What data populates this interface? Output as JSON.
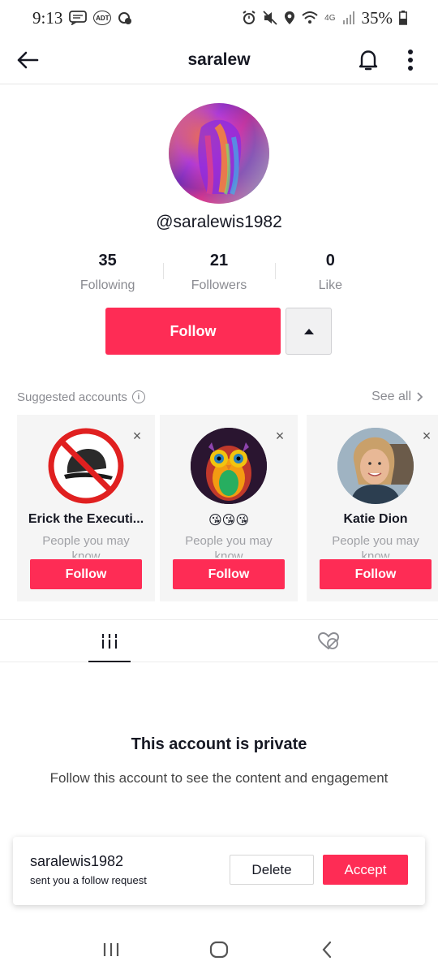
{
  "status_bar": {
    "time": "9:13",
    "network": "4G",
    "battery": "35%",
    "badge_text": "ADT"
  },
  "header": {
    "title": "saralew"
  },
  "profile": {
    "handle": "@saralewis1982",
    "stats": [
      {
        "value": "35",
        "label": "Following"
      },
      {
        "value": "21",
        "label": "Followers"
      },
      {
        "value": "0",
        "label": "Like"
      }
    ],
    "follow_label": "Follow"
  },
  "suggested": {
    "title": "Suggested accounts",
    "see_all": "See all",
    "cards": [
      {
        "name": "Erick the Executi...",
        "sub": "People you may know",
        "follow": "Follow",
        "avatar": "no-cap-icon"
      },
      {
        "name": "😘😘😘",
        "sub": "People you may know",
        "follow": "Follow",
        "avatar": "owl-art"
      },
      {
        "name": "Katie Dion",
        "sub": "People you may know",
        "follow": "Follow",
        "avatar": "photo"
      }
    ]
  },
  "tabs": [
    {
      "icon": "grid-icon",
      "active": true
    },
    {
      "icon": "liked-hidden-icon",
      "active": false
    }
  ],
  "private": {
    "title": "This account is private",
    "subtitle": "Follow this account to see the content and engagement"
  },
  "follow_request": {
    "username": "saralewis1982",
    "message": "sent you a follow request",
    "delete_label": "Delete",
    "accept_label": "Accept"
  },
  "colors": {
    "accent": "#fe2c55",
    "text_primary": "#161823",
    "text_secondary": "#8a8b91"
  }
}
